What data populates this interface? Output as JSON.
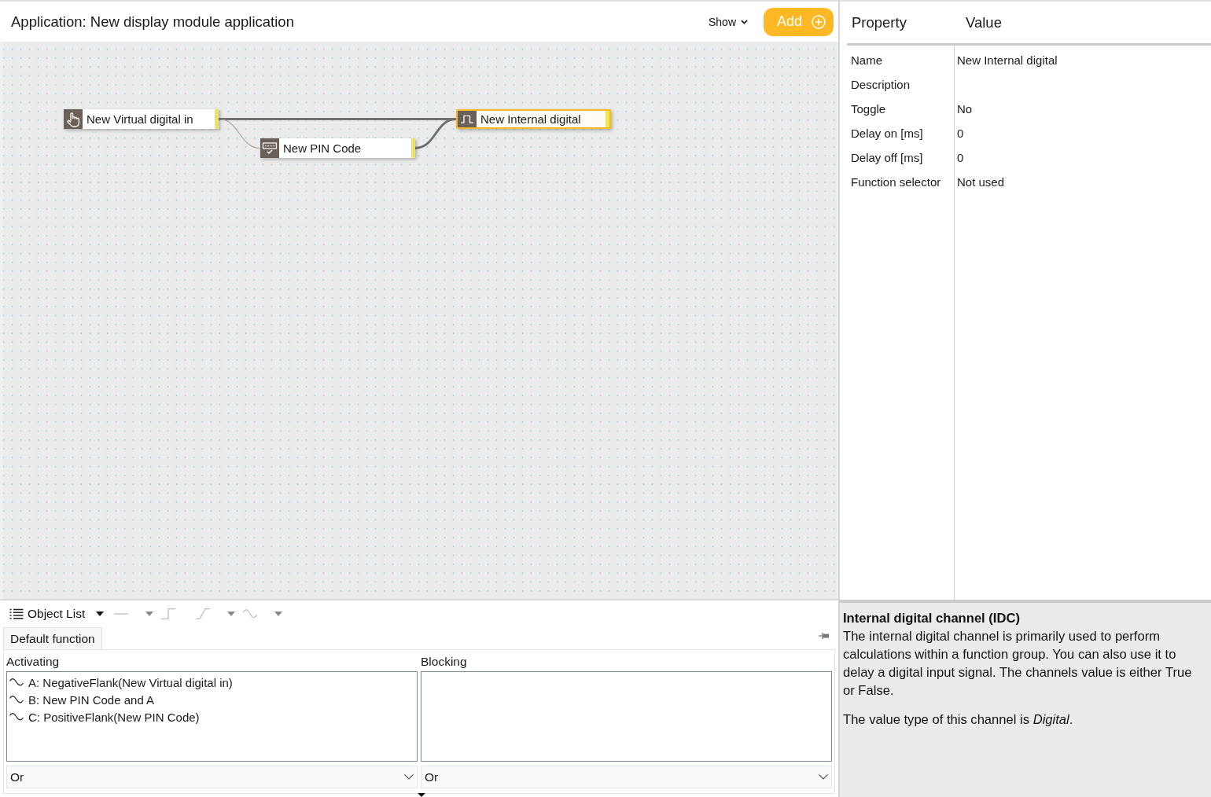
{
  "editor": {
    "title": "Application: New display module application",
    "show_menu": {
      "label": "Show"
    },
    "add_button": {
      "label": "Add"
    }
  },
  "canvas": {
    "nodes": [
      {
        "kind": "virtual_digital_in",
        "label": "New Virtual digital in",
        "selected": false
      },
      {
        "kind": "pin_code",
        "label": "New PIN Code",
        "selected": false
      },
      {
        "kind": "internal_digital",
        "label": "New Internal digital",
        "selected": true
      }
    ]
  },
  "function_panel": {
    "toolbar": {
      "object_list": {
        "label": "Object List"
      },
      "tools": [
        {
          "kind": "line",
          "disabled": true,
          "menu": true
        },
        {
          "kind": "step",
          "disabled": true,
          "menu": false
        },
        {
          "kind": "ramp",
          "disabled": true,
          "menu": true
        },
        {
          "kind": "wave",
          "disabled": true,
          "menu": true
        }
      ]
    },
    "tabs": [
      {
        "label": "Default function",
        "selected": true
      }
    ],
    "activating": {
      "label": "Activating",
      "items": [
        "A: NegativeFlank(New Virtual digital in)",
        "B: New PIN Code and A",
        "C: PositiveFlank(New PIN Code)"
      ],
      "operator": "Or"
    },
    "blocking": {
      "label": "Blocking",
      "operator": "Or"
    }
  },
  "properties": {
    "columns": [
      "Property",
      "Value"
    ],
    "rows": [
      {
        "name": "Name",
        "value": "New Internal digital"
      },
      {
        "name": "Description"
      },
      {
        "name": "Toggle",
        "value": "No"
      },
      {
        "name": "Delay on [ms]",
        "value": "0"
      },
      {
        "name": "Delay off [ms]",
        "value": "0"
      },
      {
        "name": "Function selector",
        "value": "Not used"
      }
    ]
  },
  "description": {
    "title": "Internal digital channel (IDC)",
    "paragraphs": [
      "The internal digital channel is primarily used to perform calculations within a function group. You can also use it to delay a digital input signal. The channels value is either True or False.",
      "The value type of this channel is *Digital*."
    ]
  }
}
